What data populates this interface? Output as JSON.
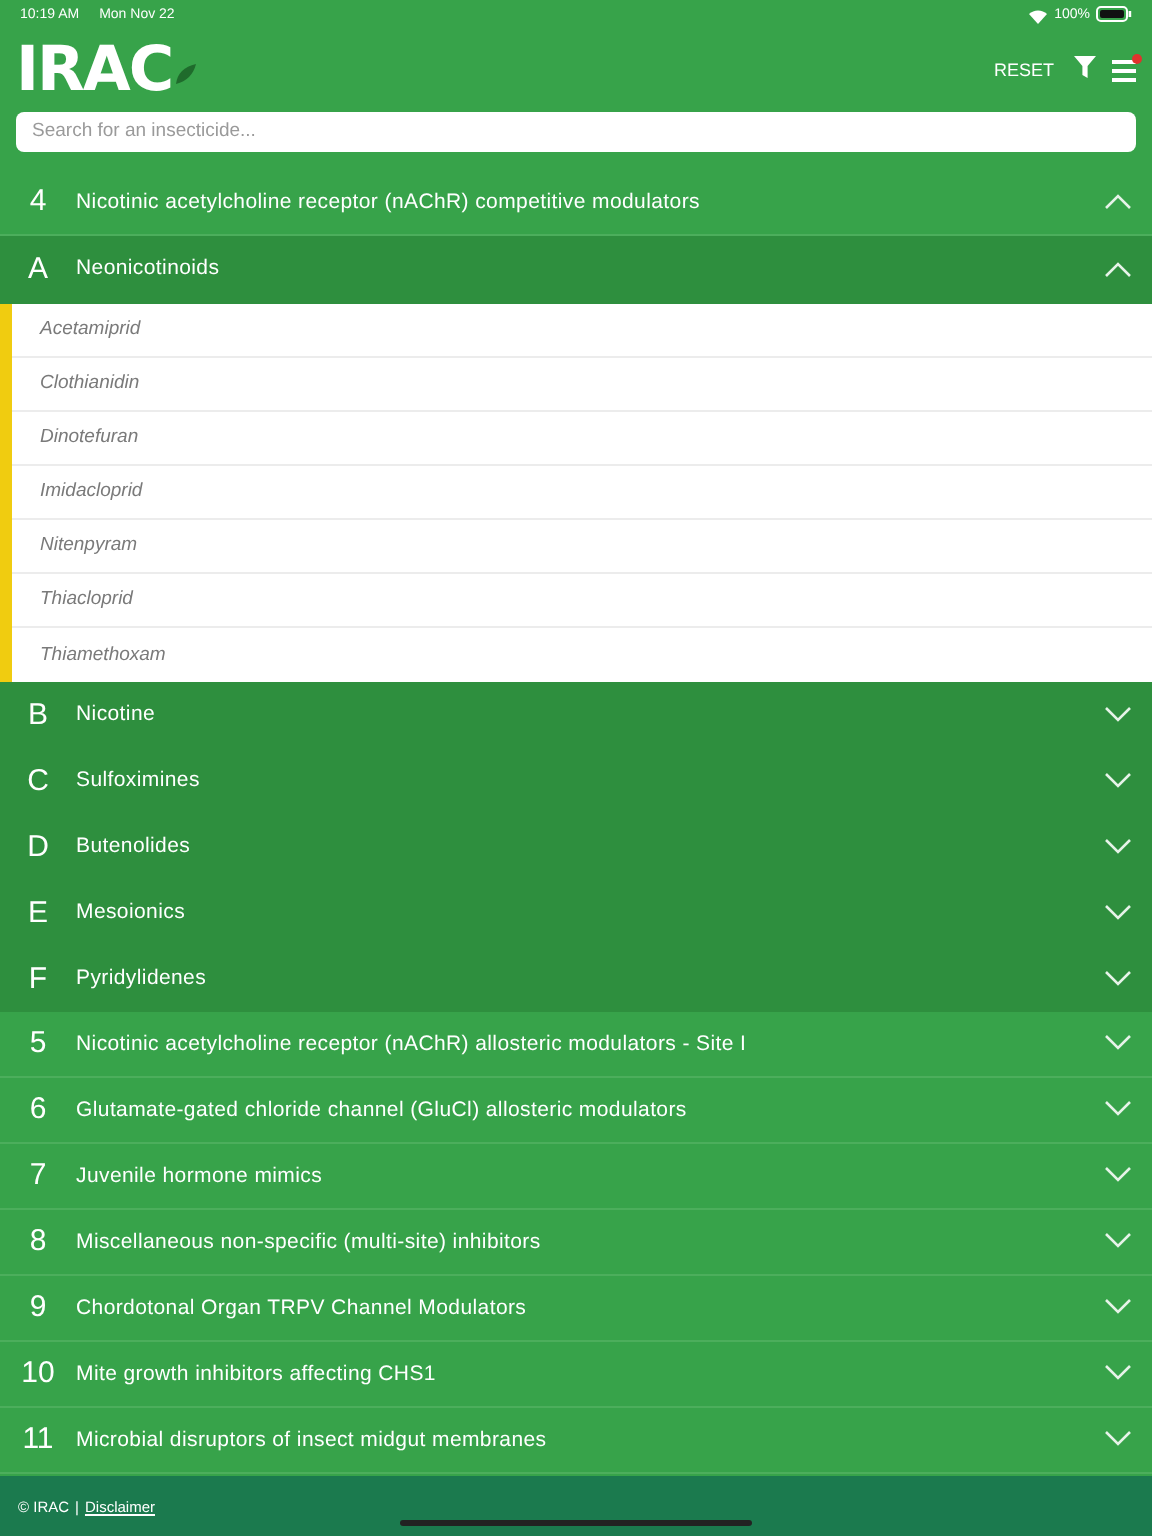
{
  "status_bar": {
    "time": "10:19 AM",
    "date": "Mon Nov 22",
    "battery": "100%"
  },
  "header": {
    "logo": "IRAC",
    "reset": "RESET",
    "menu_notification": true
  },
  "search": {
    "placeholder": "Search for an insecticide..."
  },
  "groups": [
    {
      "number": "4",
      "title": "Nicotinic acetylcholine receptor (nAChR) competitive modulators",
      "expanded": true,
      "subgroups": [
        {
          "letter": "A",
          "title": "Neonicotinoids",
          "expanded": true,
          "compounds": [
            "Acetamiprid",
            "Clothianidin",
            "Dinotefuran",
            "Imidacloprid",
            "Nitenpyram",
            "Thiacloprid",
            "Thiamethoxam"
          ]
        },
        {
          "letter": "B",
          "title": "Nicotine",
          "expanded": false
        },
        {
          "letter": "C",
          "title": "Sulfoximines",
          "expanded": false
        },
        {
          "letter": "D",
          "title": "Butenolides",
          "expanded": false
        },
        {
          "letter": "E",
          "title": "Mesoionics",
          "expanded": false
        },
        {
          "letter": "F",
          "title": "Pyridylidenes",
          "expanded": false
        }
      ]
    },
    {
      "number": "5",
      "title": "Nicotinic acetylcholine receptor (nAChR) allosteric modulators - Site I",
      "expanded": false
    },
    {
      "number": "6",
      "title": "Glutamate-gated chloride channel (GluCl) allosteric modulators",
      "expanded": false
    },
    {
      "number": "7",
      "title": "Juvenile hormone mimics",
      "expanded": false
    },
    {
      "number": "8",
      "title": "Miscellaneous non-specific (multi-site) inhibitors",
      "expanded": false
    },
    {
      "number": "9",
      "title": "Chordotonal Organ TRPV Channel Modulators",
      "expanded": false
    },
    {
      "number": "10",
      "title": "Mite growth inhibitors affecting CHS1",
      "expanded": false
    },
    {
      "number": "11",
      "title": "Microbial disruptors of insect midgut membranes",
      "expanded": false
    }
  ],
  "footer": {
    "copyright": "© IRAC",
    "separator": "|",
    "link": "Disclaimer"
  }
}
